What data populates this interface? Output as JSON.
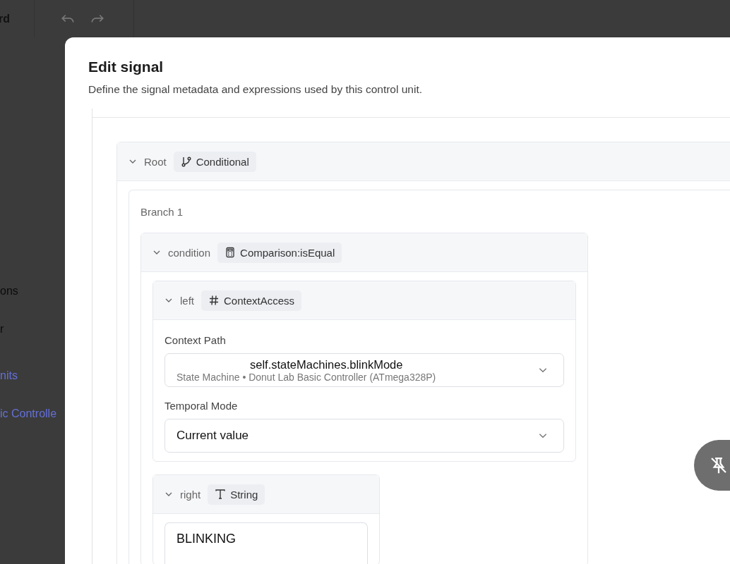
{
  "background": {
    "toolbar_label": "rd",
    "sidebar_groups": [
      [
        {
          "label": "ons",
          "kind": "text"
        },
        {
          "label": "r",
          "kind": "text"
        }
      ],
      [
        {
          "label": "nits",
          "kind": "link"
        },
        {
          "label": "ic Controlle",
          "kind": "link"
        }
      ]
    ]
  },
  "dialog": {
    "title": "Edit signal",
    "description": "Define the signal metadata and expressions used by this control unit.",
    "root": {
      "label": "Root",
      "type": "Conditional",
      "kind": "conditional",
      "expanded": true,
      "branches": [
        {
          "label": "Branch 1",
          "condition": {
            "label": "condition",
            "type": "Comparison:isEqual",
            "kind": "comparison",
            "expanded": true,
            "left": {
              "label": "left",
              "type": "ContextAccess",
              "kind": "context",
              "expanded": true,
              "context_path": {
                "label": "Context Path",
                "value": "self.stateMachines.blinkMode",
                "detail": "State Machine • Donut Lab Basic Controller (ATmega328P)"
              },
              "temporal_mode": {
                "label": "Temporal Mode",
                "value": "Current value"
              }
            },
            "right": {
              "label": "right",
              "type": "String",
              "kind": "string",
              "expanded": true,
              "value": "BLINKING"
            }
          }
        }
      ]
    }
  }
}
